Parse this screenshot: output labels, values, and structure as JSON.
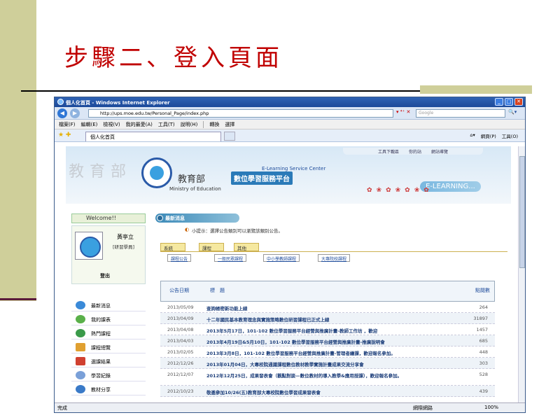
{
  "slide": {
    "title": "步驟二、登入頁面"
  },
  "browser": {
    "window_title": "個人化首頁 - Windows Internet Explorer",
    "url": "http://ups.moe.edu.tw/Personal_Page/index.php",
    "search_placeholder": "Google",
    "menu": [
      "檔案(F)",
      "編輯(E)",
      "檢視(V)",
      "我的最愛(A)",
      "工具(T)",
      "說明(H)"
    ],
    "menu_extra": [
      "轉換",
      "選擇"
    ],
    "tab_title": "個人化首頁",
    "command_bar": [
      "網頁(P)",
      "工具(O)"
    ],
    "status_text": "完成",
    "status_zone": "網際網路",
    "zoom": "100%"
  },
  "site": {
    "top_links": [
      "工具下載區",
      "你的站",
      "網站導覽"
    ],
    "org_name": "教育部",
    "org_name_en": "Ministry of Education",
    "service_name": "數位學習服務平台",
    "service_en": "E-Learning Service Center",
    "banner_text": "E-LEARNING...",
    "banner_bg_text": "教育部",
    "welcome": "Welcome!!",
    "user_name": "黃亭立",
    "user_role": "[研習學員]",
    "logout": "登出",
    "sidebar": [
      "最新消息",
      "我的課表",
      "熱門課程",
      "課程總覽",
      "選課結果",
      "學習紀錄",
      "教材分享"
    ],
    "news_title": "最新消息",
    "hint": "小提示：選擇公告類別可以瀏覽該類別公告。",
    "categories": [
      "系統",
      "課程",
      "其他"
    ],
    "subcats": [
      "課程公告",
      "一般民眾課程",
      "中小學教師課程",
      "大專院校課程"
    ],
    "table_headers": {
      "date": "公告日期",
      "title": "標　題",
      "count": "點閱數"
    },
    "news": [
      {
        "date": "2013/05/09",
        "title": "查詢帳密新功能上線",
        "count": "264"
      },
      {
        "date": "2013/04/09",
        "title": "十二年國民基本教育理念與實施策略數位研習課程已正式上線",
        "count": "31897"
      },
      {
        "date": "2013/04/08",
        "title": "2013年5月17日，101-102 數位學習服務平台經營與推廣計畫-教師工作坊 ，歡迎",
        "count": "1457"
      },
      {
        "date": "2013/04/03",
        "title": "2013年4月19日&5月10日，101-102 數位學習服務平台經營與推廣計畫-推廣說明會",
        "count": "685"
      },
      {
        "date": "2013/02/05",
        "title": "2013年3月8日，101-102 數位學習服務平台經營與推廣計畫-管理者繪課，歡迎報名參加。",
        "count": "448"
      },
      {
        "date": "2012/12/26",
        "title": "2013年01月04日，大專校院通識課程數位教材教學實施計畫成果交流分享會",
        "count": "303"
      },
      {
        "date": "2012/12/07",
        "title": "2012年12月25日，成果發表會（觀點對談—數位教材的導入教學&應用授課），歡迎報名參加。",
        "count": "528"
      },
      {
        "date": "2012/10/23",
        "title": "敬邀參加10/26(五)教育部大專校院數位學習成果發表會",
        "count": "439"
      }
    ]
  }
}
